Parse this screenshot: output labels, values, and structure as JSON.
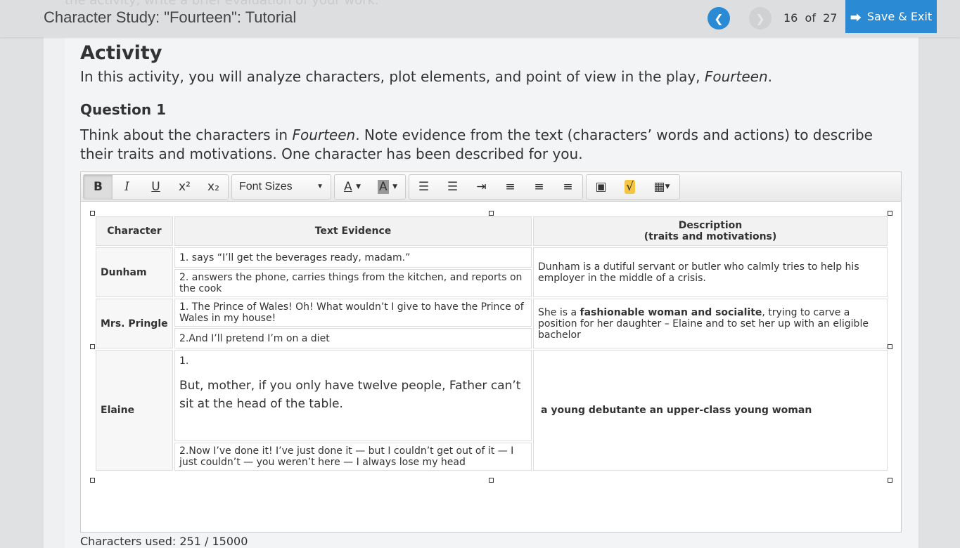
{
  "header": {
    "ghost_text": "the activity, write a brief evaluation of your work.",
    "title": "Character Study: \"Fourteen\": Tutorial",
    "page_current": "16",
    "page_of": "of",
    "page_total": "27",
    "save_exit": "Save & Exit"
  },
  "activity": {
    "heading": "Activity",
    "intro_pre": "In this activity, you will analyze characters, plot elements, and point of view in the play, ",
    "intro_italic": "Fourteen",
    "intro_post": "."
  },
  "question": {
    "heading": "Question 1",
    "text_pre": "Think about the characters in ",
    "text_italic": "Fourteen",
    "text_post": ". Note evidence from the text (characters’ words and actions) to describe their traits and motivations. One character has been described for you."
  },
  "toolbar": {
    "bold": "B",
    "italic": "I",
    "underline": "U",
    "superscript": "x²",
    "subscript": "x₂",
    "font_sizes": "Font Sizes",
    "font_color": "A",
    "bg_color": "A"
  },
  "table": {
    "headers": [
      "Character",
      "Text Evidence",
      "Description",
      "(traits and motivations)"
    ],
    "rows": [
      {
        "character": "Dunham",
        "evidence": [
          "1. says “I’ll get the beverages ready, madam.”",
          "2. answers the phone, carries things from the kitchen, and reports on the cook"
        ],
        "description": "Dunham is a dutiful servant or butler who calmly tries to help his employer in the middle of a crisis."
      },
      {
        "character": "Mrs. Pringle",
        "evidence": [
          "1. The Prince of Wales! Oh! What wouldn’t I give to have the Prince of Wales in my house!",
          "2.And I’ll pretend I’m on a diet"
        ],
        "description_pre": "She is a ",
        "description_bold": "fashionable woman and socialite",
        "description_post": ", trying to carve a position for her daughter – Elaine and to set her up with an eligible bachelor"
      },
      {
        "character": "Elaine",
        "evidence_num": "1.",
        "evidence_quote": "But, mother, if you only have twelve people, Father can’t sit at the head of the table.",
        "evidence2": "2.Now I’ve done it! I’ve just done it — but I couldn’t get out of it — I just couldn’t — you weren’t here — I always lose my head",
        "description": "a young debutante an upper-class young woman"
      }
    ]
  },
  "footer": {
    "chars_used": "Characters used: 251 / 15000"
  }
}
